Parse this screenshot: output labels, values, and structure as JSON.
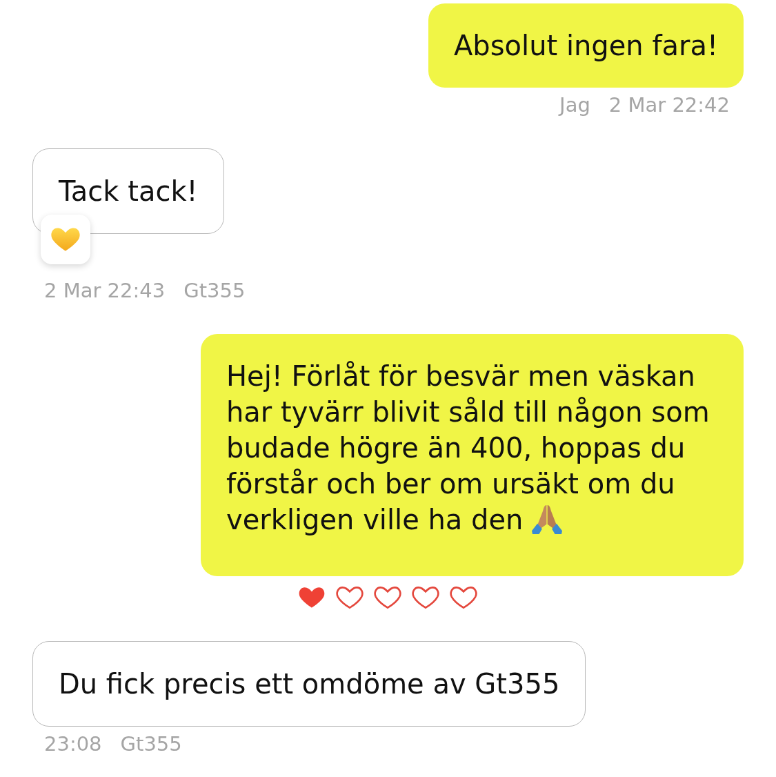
{
  "messages": [
    {
      "kind": "outgoing",
      "text": "Absolut ingen fara!",
      "reacted": false,
      "sender": "Jag",
      "time": "2 Mar 22:42"
    },
    {
      "kind": "incoming",
      "text": "Tack tack!",
      "reacted": true,
      "time": "2 Mar 22:43",
      "sender": "Gt355"
    },
    {
      "kind": "outgoing",
      "text": "Hej! Förlåt för besvär men väskan har tyvärr blivit såld till någon som budade högre än 400, hoppas du förstår och ber om ursäkt om du verkligen ville ha den",
      "ends_with_emoji": true,
      "reacted": false,
      "rating": {
        "stars": 1
      }
    },
    {
      "kind": "incoming",
      "text": "Du fick precis ett omdöme av Gt355",
      "reacted": false,
      "time": "23:08",
      "sender": "Gt355"
    }
  ]
}
